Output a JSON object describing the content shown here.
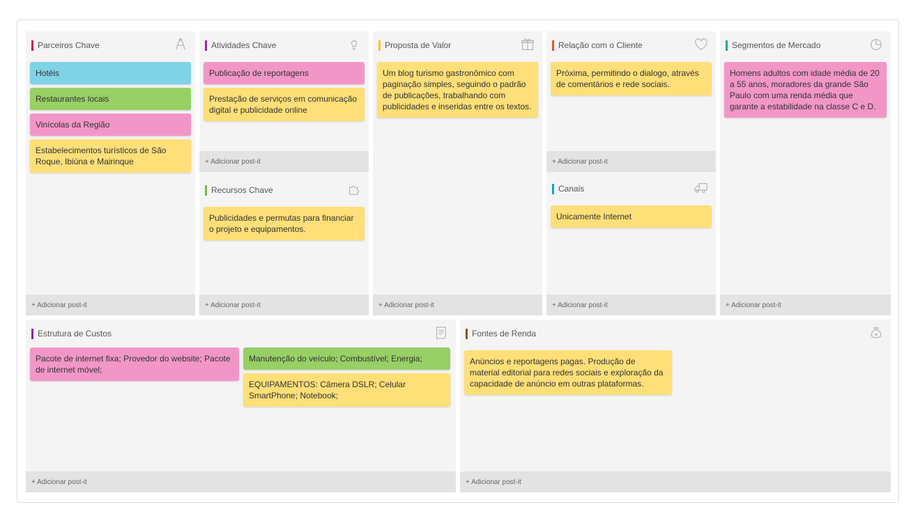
{
  "add_label": "+ Adicionar post-it",
  "colors": {
    "blue": "#7fd3e6",
    "green": "#97d065",
    "pink": "#f296c8",
    "yellow": "#ffdf78"
  },
  "sections": {
    "parceiros": {
      "title": "Parceiros Chave",
      "accent": "#c2185b",
      "icon": "handshake-icon",
      "notes": [
        {
          "text": "Hotéis",
          "color": "blue"
        },
        {
          "text": "Restaurantes locais",
          "color": "green"
        },
        {
          "text": "Vinícolas da Região",
          "color": "pink"
        },
        {
          "text": "Estabelecimentos turísticos de São Roque, Ibiúna e Mairinque",
          "color": "yellow"
        }
      ]
    },
    "atividades": {
      "title": "Atividades Chave",
      "accent": "#9c27b0",
      "icon": "lightbulb-icon",
      "notes": [
        {
          "text": "Publicação de reportagens",
          "color": "pink"
        },
        {
          "text": "Prestação de serviços em comunicação digital e publicidade online",
          "color": "yellow"
        }
      ]
    },
    "recursos": {
      "title": "Recursos Chave",
      "accent": "#7cb342",
      "icon": "puzzle-icon",
      "notes": [
        {
          "text": "Publicidades e permutas para financiar o projeto e equipamentos.",
          "color": "yellow"
        }
      ]
    },
    "proposta": {
      "title": "Proposta de Valor",
      "accent": "#fbc02d",
      "icon": "gift-icon",
      "notes": [
        {
          "text": "Um blog turismo gastronômico com paginação simples, seguindo o padrão de publicações, trabalhando com publicidades e inseridas entre os textos.",
          "color": "yellow"
        }
      ]
    },
    "relacao": {
      "title": "Relação com o Cliente",
      "accent": "#f4511e",
      "icon": "heart-icon",
      "notes": [
        {
          "text": "Próxima, permitindo o dialogo, através de comentários e rede sociais.",
          "color": "yellow"
        }
      ]
    },
    "canais": {
      "title": "Canais",
      "accent": "#00acc1",
      "icon": "truck-icon",
      "notes": [
        {
          "text": "Unicamente Internet",
          "color": "yellow"
        }
      ]
    },
    "segmentos": {
      "title": "Segmentos de Mercado",
      "accent": "#26a69a",
      "icon": "pie-chart-icon",
      "notes": [
        {
          "text": "Homens adultos com idade média de 20 a 55 anos, moradores da grande São Paulo com uma renda média que garante a estabilidade na classe C e D.",
          "color": "pink"
        }
      ]
    },
    "custos": {
      "title": "Estrutura de Custos",
      "accent": "#8e24aa",
      "icon": "receipt-icon",
      "notes_left": [
        {
          "text": "Pacote de internet fixa; Provedor do website; Pacote de internet móvel;",
          "color": "pink"
        }
      ],
      "notes_right": [
        {
          "text": "Manutenção do veículo; Combustível; Energia;",
          "color": "green"
        },
        {
          "text": "EQUIPAMENTOS: Câmera DSLR; Celular SmartPhone; Notebook;",
          "color": "yellow"
        }
      ]
    },
    "fontes": {
      "title": "Fontes de Renda",
      "accent": "#8d5524",
      "icon": "money-bag-icon",
      "notes": [
        {
          "text": "Anúncios e reportagens pagas. Produção de material editorial para redes sociais e exploração da capacidade de anúncio em outras plataformas.",
          "color": "yellow"
        }
      ]
    }
  }
}
